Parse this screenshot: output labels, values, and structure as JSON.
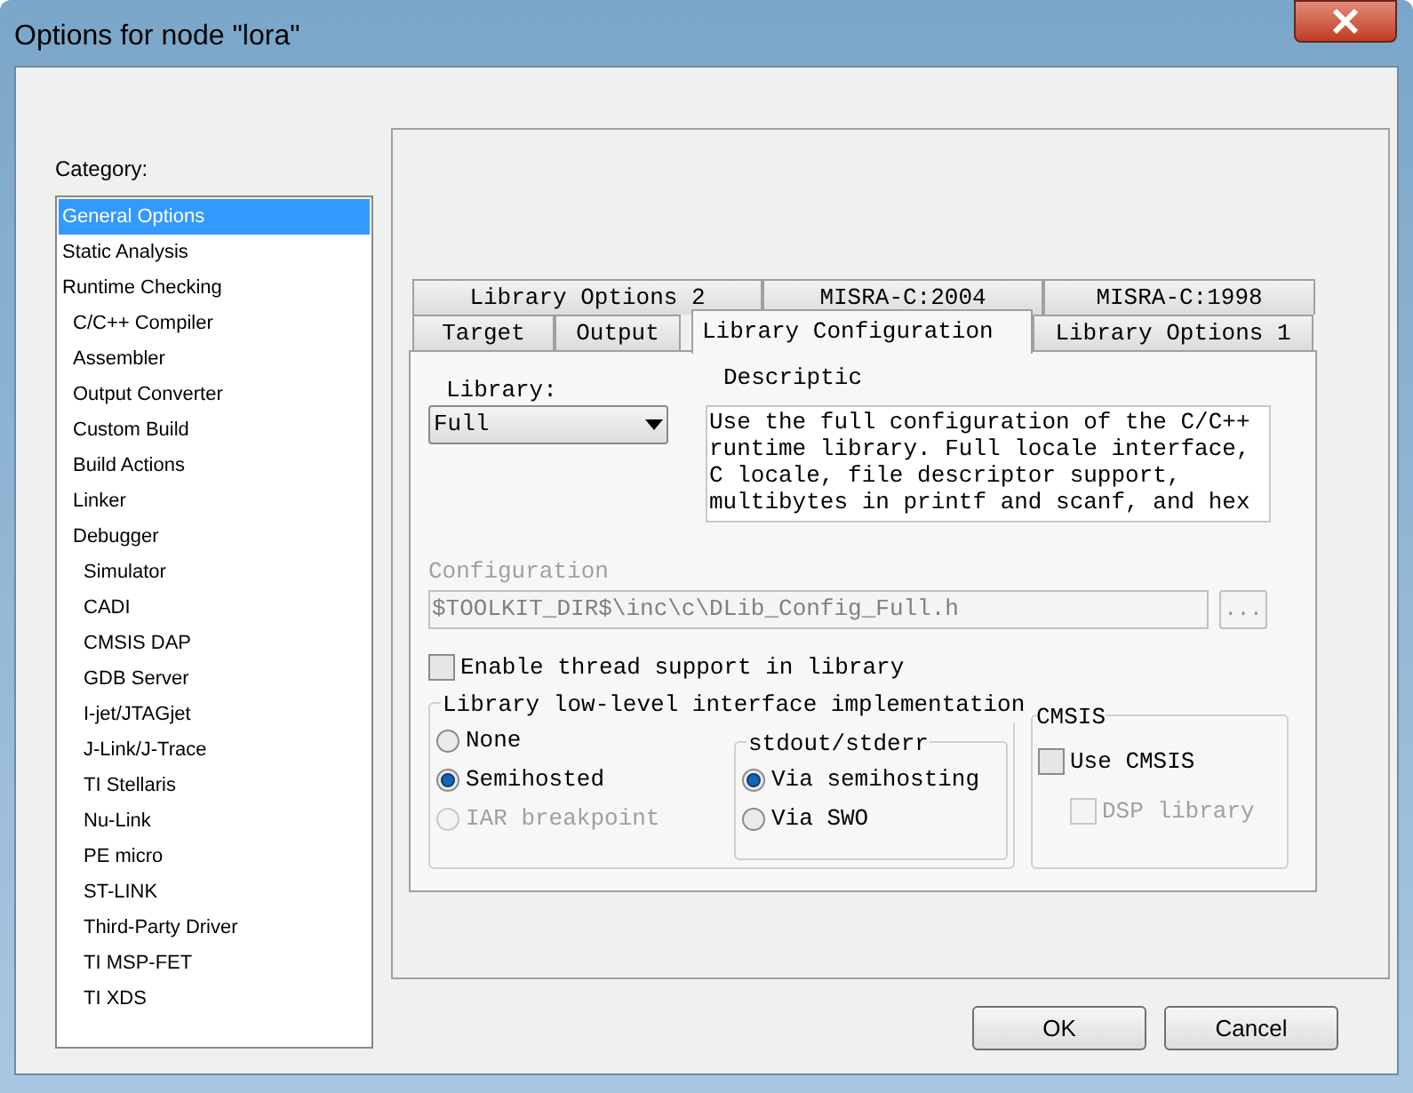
{
  "window": {
    "title": "Options for node \"lora\""
  },
  "category": {
    "label": "Category:",
    "items": [
      {
        "label": "General Options",
        "selected": true
      },
      {
        "label": "Static Analysis",
        "selected": false
      },
      {
        "label": "Runtime Checking",
        "selected": false,
        "children": [
          {
            "label": "C/C++ Compiler",
            "selected": false
          },
          {
            "label": "Assembler",
            "selected": false
          },
          {
            "label": "Output Converter",
            "selected": false
          },
          {
            "label": "Custom Build",
            "selected": false
          },
          {
            "label": "Build Actions",
            "selected": false
          },
          {
            "label": "Linker",
            "selected": false
          },
          {
            "label": "Debugger",
            "selected": false,
            "children": [
              {
                "label": "Simulator",
                "selected": false
              },
              {
                "label": "CADI",
                "selected": false
              },
              {
                "label": "CMSIS DAP",
                "selected": false
              },
              {
                "label": "GDB Server",
                "selected": false
              },
              {
                "label": "I-jet/JTAGjet",
                "selected": false
              },
              {
                "label": "J-Link/J-Trace",
                "selected": false
              },
              {
                "label": "TI Stellaris",
                "selected": false
              },
              {
                "label": "Nu-Link",
                "selected": false
              },
              {
                "label": "PE micro",
                "selected": false
              },
              {
                "label": "ST-LINK",
                "selected": false
              },
              {
                "label": "Third-Party Driver",
                "selected": false
              },
              {
                "label": "TI MSP-FET",
                "selected": false
              },
              {
                "label": "TI XDS",
                "selected": false
              }
            ]
          }
        ]
      }
    ]
  },
  "tab_rows": [
    {
      "tabs": [
        {
          "label": "Library Options 2",
          "selected": false
        },
        {
          "label": "MISRA-C:2004",
          "selected": false
        },
        {
          "label": "MISRA-C:1998",
          "selected": false
        }
      ]
    },
    {
      "tabs": [
        {
          "label": "Target",
          "selected": false
        },
        {
          "label": "Output",
          "selected": false
        },
        {
          "label": "Library Configuration",
          "selected": true
        },
        {
          "label": "Library Options 1",
          "selected": false
        }
      ]
    }
  ],
  "library": {
    "label": "Library:",
    "value": "Full"
  },
  "description": {
    "label": "Descriptic",
    "lines": [
      "Use the full configuration of the C/C++",
      "runtime library. Full locale interface,",
      "C locale, file descriptor support,",
      "multibytes in printf and scanf, and hex"
    ]
  },
  "configuration": {
    "label": "Configuration",
    "value": "$TOOLKIT_DIR$\\inc\\c\\DLib_Config_Full.h",
    "disabled": true,
    "browse_label": "..."
  },
  "thread_support": {
    "label": "Enable thread support in library",
    "checked": false,
    "disabled": false
  },
  "low_level": {
    "label": "Library low-level interface implementation",
    "options": [
      {
        "label": "None",
        "selected": false,
        "disabled": false
      },
      {
        "label": "Semihosted",
        "selected": true,
        "disabled": false
      },
      {
        "label": "IAR breakpoint",
        "selected": false,
        "disabled": true
      }
    ]
  },
  "stdout": {
    "label": "stdout/stderr",
    "options": [
      {
        "label": "Via semihosting",
        "selected": true,
        "disabled": false
      },
      {
        "label": "Via SWO",
        "selected": false,
        "disabled": false
      }
    ]
  },
  "cmsis": {
    "label": "CMSIS",
    "use_cmsis": {
      "label": "Use CMSIS",
      "checked": false,
      "disabled": false
    },
    "dsp": {
      "label": "DSP library",
      "checked": false,
      "disabled": true
    }
  },
  "buttons": [
    {
      "label": "OK"
    },
    {
      "label": "Cancel"
    }
  ]
}
